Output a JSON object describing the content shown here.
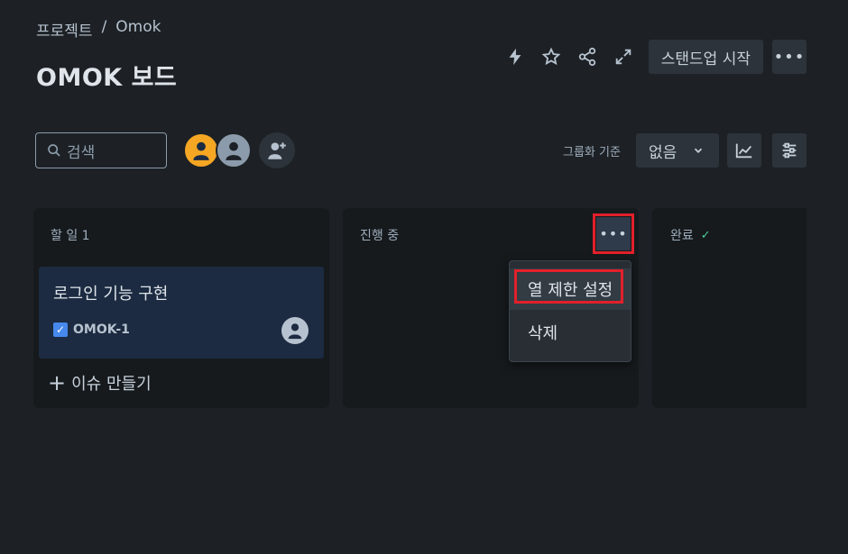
{
  "breadcrumb": {
    "parent": "프로젝트",
    "separator": "/",
    "current": "Omok"
  },
  "page_title": "OMOK 보드",
  "header": {
    "standup_label": "스탠드업 시작",
    "more_label": "•••"
  },
  "search": {
    "placeholder": "검색"
  },
  "toolbar": {
    "group_label": "그룹화 기준",
    "group_value": "없음"
  },
  "columns": [
    {
      "title": "할 일 1",
      "create_label": "이슈 만들기"
    },
    {
      "title": "진행 중",
      "more_label": "•••"
    },
    {
      "title": "완료",
      "check": "✓"
    }
  ],
  "card": {
    "title": "로그인 기능 구현",
    "key": "OMOK-1"
  },
  "menu": {
    "items": [
      "열 제한 설정",
      "삭제"
    ]
  },
  "colors": {
    "background": "#1d2125",
    "column": "#161a1d",
    "card": "#1c2b41",
    "highlight": "#e2202a",
    "success": "#4bce97"
  }
}
